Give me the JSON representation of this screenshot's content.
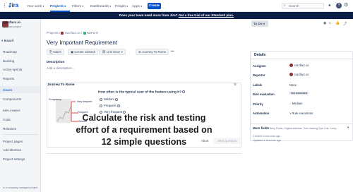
{
  "topnav": {
    "your_work": "Your work",
    "projects": "Projects",
    "filters": "Filters",
    "dashboards": "Dashboards",
    "people": "People",
    "apps": "Apps",
    "create": "Create",
    "search_placeholder": "Search"
  },
  "banner": {
    "text": "Does your team need more from Jira? ",
    "link": "Get a free trial of our Standard plan."
  },
  "sidebar": {
    "project_name": "raccfacc.io",
    "project_type": "Software project",
    "board": "Board",
    "items": [
      "Roadmap",
      "Backlog",
      "Active sprints",
      "Reports",
      "Issues",
      "Components"
    ],
    "dev_heading": "DEPLOYMENT",
    "dev_items": [
      "Code",
      "Releases"
    ],
    "bottom_items": [
      "Project pages",
      "Add shortcut",
      "Project settings"
    ],
    "footer": "in a company-managed project"
  },
  "issue": {
    "breadcrumb": [
      "Projects",
      "raccfacc.io",
      "RZFZ-8"
    ],
    "title": "Very Important Requirement",
    "toolbar": [
      "Attach",
      "Create subtask",
      "Link issue",
      "Journey To Rome"
    ],
    "description_label": "Description",
    "description_placeholder": "Add a description..."
  },
  "panel": {
    "title": "Journey To Rome",
    "question": "How often is the typical user of the feature using it?",
    "options": [
      "Seldom",
      "Frequent",
      "Very frequent"
    ],
    "graph_labels": {
      "y_label": "Frequency",
      "very_frequent": "Very frequent",
      "frequent": "Frequent",
      "seldom": "Seldom"
    },
    "abort": "Abort",
    "next": "Next question"
  },
  "overlay_text": [
    "Calculate the risk and testing",
    "effort of a requirement based on",
    "12 simple questions"
  ],
  "details": {
    "status": "To Do",
    "heading": "Details",
    "rows": [
      {
        "label": "Assignee",
        "value": "raccfacc.io"
      },
      {
        "label": "Reporter",
        "value": "raccfacc.io"
      },
      {
        "label": "Labels",
        "value": "None"
      },
      {
        "label": "Risk evaluation",
        "value": "Not assessed"
      },
      {
        "label": "Priority",
        "value": "Medium"
      },
      {
        "label": "Automation",
        "value": "Rule executions"
      }
    ],
    "more_fields": "More fields",
    "more_fields_desc": "Story Points, Original estimate, Time tracking, Epic Link, Comp...",
    "created": "Created 4 seconds ago",
    "updated": "Updated 4 seconds ago"
  },
  "colors": {
    "brand": "#0052cc",
    "banner_bg": "#0b1e45",
    "sidebar_bg": "#f4f5f7"
  }
}
